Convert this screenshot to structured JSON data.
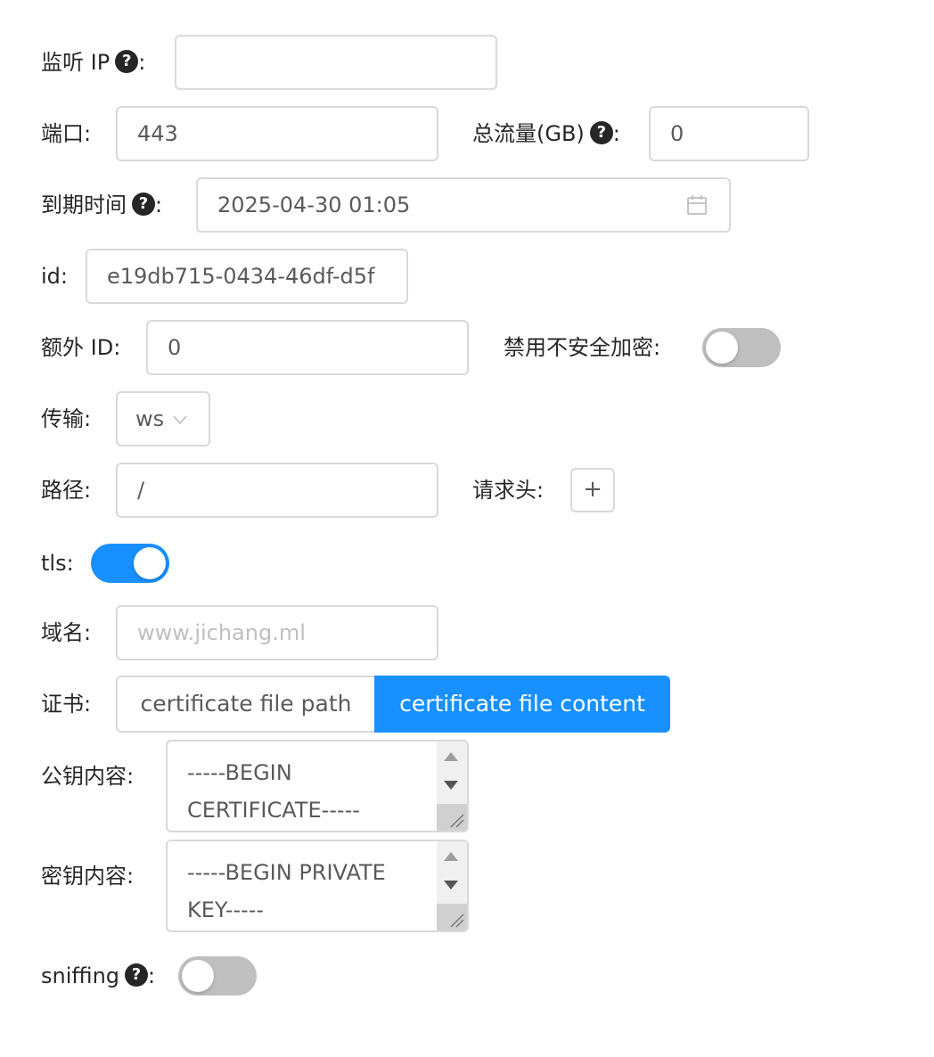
{
  "listen_ip": {
    "label": "监听 IP",
    "help_glyph": "?",
    "value": ""
  },
  "port": {
    "label": "端口",
    "value": "443"
  },
  "total_traffic": {
    "label": "总流量(GB)",
    "help_glyph": "?",
    "value": "0"
  },
  "expiry": {
    "label": "到期时间",
    "help_glyph": "?",
    "value": "2025-04-30 01:05",
    "icon": "calendar-icon"
  },
  "id_field": {
    "label": "id",
    "value": "e19db715-0434-46df-d5f"
  },
  "extra_id": {
    "label": "额外 ID",
    "value": "0"
  },
  "disable_insecure": {
    "label": "禁用不安全加密",
    "checked": false
  },
  "transport": {
    "label": "传输",
    "value": "ws",
    "icon": "chevron-down-icon"
  },
  "path": {
    "label": "路径",
    "value": "/"
  },
  "headers": {
    "label": "请求头",
    "add_label": "+"
  },
  "tls": {
    "label": "tls",
    "checked": true
  },
  "domain": {
    "label": "域名",
    "placeholder": "www.jichang.ml"
  },
  "certificate": {
    "label": "证书",
    "options": [
      "certificate file path",
      "certificate file content"
    ],
    "selected": "certificate file content"
  },
  "public_key": {
    "label": "公钥内容",
    "value": "-----BEGIN CERTIFICATE-----"
  },
  "private_key": {
    "label": "密钥内容",
    "value": "-----BEGIN PRIVATE KEY-----"
  },
  "sniffing": {
    "label": "sniffing",
    "help_glyph": "?",
    "checked": false
  },
  "colors": {
    "primary": "#1890ff",
    "border": "#d9d9d9",
    "switch_off": "#bfbfbf"
  }
}
